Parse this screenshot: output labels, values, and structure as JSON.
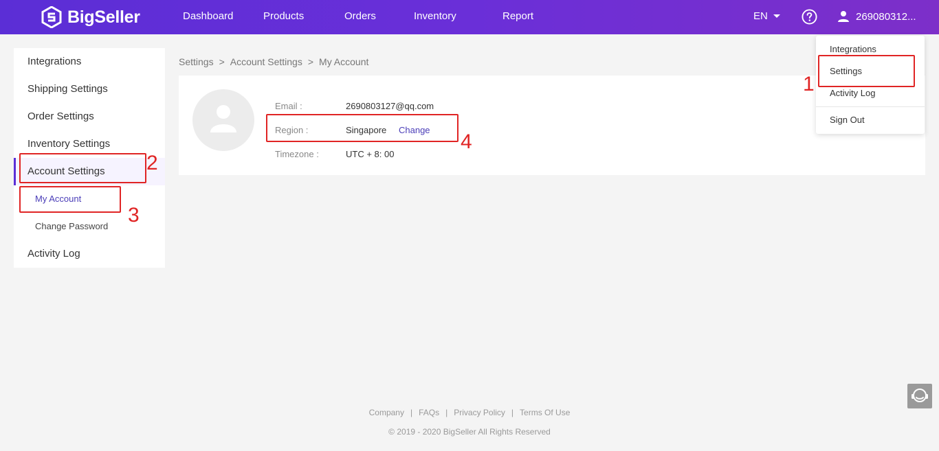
{
  "brand": {
    "name": "BigSeller"
  },
  "nav": {
    "items": [
      "Dashboard",
      "Products",
      "Orders",
      "Inventory",
      "Report"
    ],
    "lang": "EN",
    "user": "269080312..."
  },
  "dropdown": {
    "items": [
      "Integrations",
      "Settings",
      "Activity Log",
      "Sign Out"
    ]
  },
  "sidebar": {
    "items": [
      "Integrations",
      "Shipping Settings",
      "Order Settings",
      "Inventory Settings",
      "Account Settings"
    ],
    "sub_items": [
      "My Account",
      "Change Password"
    ],
    "last_item": "Activity Log"
  },
  "breadcrumb": [
    "Settings",
    ">",
    "Account Settings",
    ">",
    "My Account"
  ],
  "account": {
    "email_label": "Email :",
    "email_value": "2690803127@qq.com",
    "region_label": "Region :",
    "region_value": "Singapore",
    "region_change": "Change",
    "timezone_label": "Timezone :",
    "timezone_value": "UTC + 8: 00"
  },
  "annotations": [
    "1",
    "2",
    "3",
    "4"
  ],
  "footer": {
    "links": [
      "Company",
      "FAQs",
      "Privacy Policy",
      "Terms Of Use"
    ],
    "separator": "|",
    "copyright": "© 2019 - 2020 BigSeller All Rights Reserved"
  },
  "colors": {
    "accent": "#5b2ed6",
    "link": "#4a3db8",
    "annotation": "#e02424"
  }
}
